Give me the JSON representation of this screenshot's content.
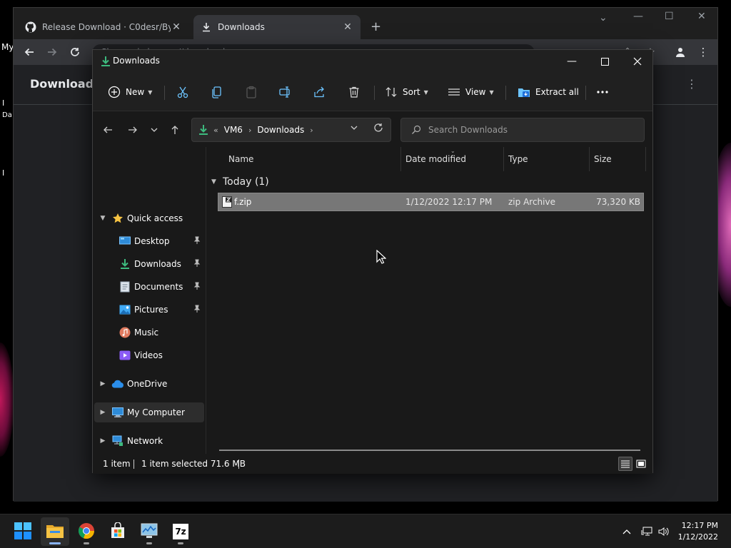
{
  "desktop": {
    "label": "My",
    "fragments": [
      "I",
      "Da",
      "I"
    ]
  },
  "chrome": {
    "tabs": [
      {
        "title": "Release Download · C0desr/Bypa",
        "active": false
      },
      {
        "title": "Downloads",
        "active": true
      }
    ],
    "omnibox_text": "Chrome  |  chrome://downloads",
    "page_title": "Downloads"
  },
  "explorer": {
    "title": "Downloads",
    "command_bar": {
      "new": "New",
      "sort": "Sort",
      "view": "View",
      "extract_all": "Extract all"
    },
    "address": {
      "overflow": "«",
      "crumbs": [
        "VM6",
        "Downloads"
      ]
    },
    "search": {
      "placeholder": "Search Downloads"
    },
    "nav_pane": {
      "quick_access": "Quick access",
      "items": [
        {
          "label": "Desktop",
          "icon": "desktop-icon",
          "pinned": true
        },
        {
          "label": "Downloads",
          "icon": "downloads-icon",
          "pinned": true
        },
        {
          "label": "Documents",
          "icon": "documents-icon",
          "pinned": true
        },
        {
          "label": "Pictures",
          "icon": "pictures-icon",
          "pinned": true
        },
        {
          "label": "Music",
          "icon": "music-icon",
          "pinned": false
        },
        {
          "label": "Videos",
          "icon": "videos-icon",
          "pinned": false
        }
      ],
      "onedrive": "OneDrive",
      "my_computer": "My Computer",
      "network": "Network"
    },
    "columns": [
      "Name",
      "Date modified",
      "Type",
      "Size"
    ],
    "group": {
      "label": "Today (1)"
    },
    "files": [
      {
        "name": "f.zip",
        "date_modified": "1/12/2022 12:17 PM",
        "type": "zip Archive",
        "size": "73,320 KB",
        "selected": true
      }
    ],
    "status": {
      "count": "1 item",
      "selection": "1 item selected  71.6 MB"
    }
  },
  "taskbar": {
    "apps": [
      "start-icon",
      "file-explorer-icon",
      "chrome-icon",
      "store-icon",
      "resource-monitor-icon",
      "7zip-icon"
    ],
    "seven_zip_label": "7z",
    "clock": {
      "time": "12:17 PM",
      "date": "1/12/2022"
    }
  },
  "colors": {
    "explorer_bg": "#191919",
    "selection": "#777777",
    "accent_green": "#3dba7e",
    "accent_blue": "#4cc2ff",
    "folder_yellow": "#f6c343"
  }
}
